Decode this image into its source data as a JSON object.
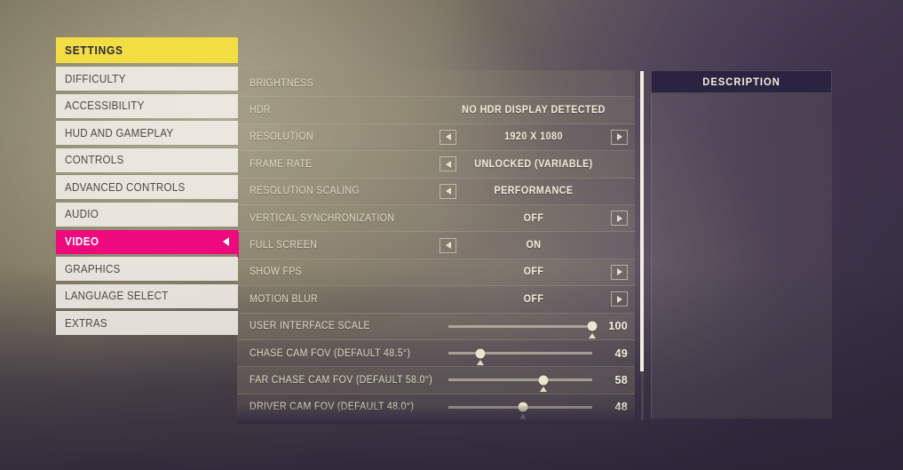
{
  "sidebar": {
    "header": "SETTINGS",
    "items": [
      {
        "label": "DIFFICULTY",
        "active": false
      },
      {
        "label": "ACCESSIBILITY",
        "active": false
      },
      {
        "label": "HUD AND GAMEPLAY",
        "active": false
      },
      {
        "label": "CONTROLS",
        "active": false
      },
      {
        "label": "ADVANCED CONTROLS",
        "active": false
      },
      {
        "label": "AUDIO",
        "active": false
      },
      {
        "label": "VIDEO",
        "active": true
      },
      {
        "label": "GRAPHICS",
        "active": false
      },
      {
        "label": "LANGUAGE SELECT",
        "active": false
      },
      {
        "label": "EXTRAS",
        "active": false
      }
    ]
  },
  "settings": {
    "rows": [
      {
        "name": "BRIGHTNESS",
        "type": "label",
        "value": "",
        "left_arrow": false,
        "right_arrow": false,
        "marked": false
      },
      {
        "name": "HDR",
        "type": "text",
        "value": "NO HDR DISPLAY DETECTED",
        "left_arrow": false,
        "right_arrow": false,
        "marked": false
      },
      {
        "name": "RESOLUTION",
        "type": "option",
        "value": "1920 X 1080",
        "left_arrow": true,
        "right_arrow": true,
        "marked": false
      },
      {
        "name": "FRAME RATE",
        "type": "option",
        "value": "UNLOCKED (VARIABLE)",
        "left_arrow": true,
        "right_arrow": false,
        "marked": false
      },
      {
        "name": "RESOLUTION SCALING",
        "type": "option",
        "value": "PERFORMANCE",
        "left_arrow": true,
        "right_arrow": false,
        "marked": false
      },
      {
        "name": "VERTICAL SYNCHRONIZATION",
        "type": "option",
        "value": "OFF",
        "left_arrow": false,
        "right_arrow": true,
        "marked": false
      },
      {
        "name": "FULL SCREEN",
        "type": "option",
        "value": "ON",
        "left_arrow": true,
        "right_arrow": false,
        "marked": true
      },
      {
        "name": "SHOW FPS",
        "type": "option",
        "value": "OFF",
        "left_arrow": false,
        "right_arrow": true,
        "marked": false
      },
      {
        "name": "MOTION BLUR",
        "type": "option",
        "value": "OFF",
        "left_arrow": false,
        "right_arrow": true,
        "marked": false
      },
      {
        "name": "USER INTERFACE SCALE",
        "type": "slider",
        "value": "100",
        "percent": 100,
        "marker": 100,
        "marked": false
      },
      {
        "name": "CHASE CAM FOV (DEFAULT 48.5°)",
        "type": "slider",
        "value": "49",
        "percent": 22,
        "marker": 22,
        "marked": false
      },
      {
        "name": "FAR CHASE CAM FOV (DEFAULT 58.0°)",
        "type": "slider",
        "value": "58",
        "percent": 66,
        "marker": 66,
        "marked": false
      },
      {
        "name": "DRIVER CAM FOV (DEFAULT 48.0°)",
        "type": "slider",
        "value": "48",
        "percent": 52,
        "marker": 52,
        "marked": false
      }
    ]
  },
  "description": {
    "header": "DESCRIPTION",
    "body": ""
  },
  "colors": {
    "accent_magenta": "#ec0a7d",
    "accent_yellow": "#f2dd42",
    "header_navy": "#2b2440",
    "text_cream": "#ded9c4"
  }
}
